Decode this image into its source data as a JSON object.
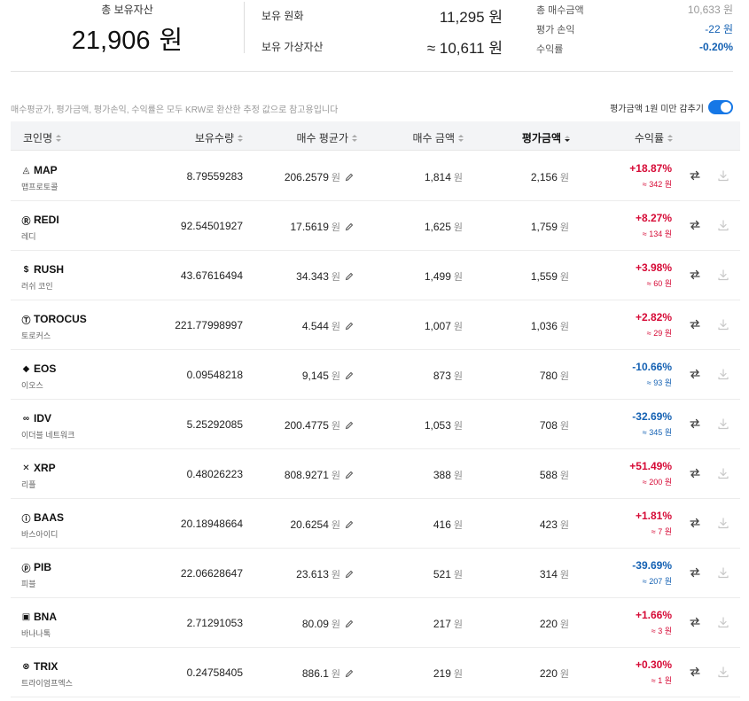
{
  "summary": {
    "total_label": "총 보유자산",
    "total_value": "21,906",
    "total_unit": "원",
    "krw_label": "보유 원화",
    "krw_value": "11,295 원",
    "crypto_label": "보유 가상자산",
    "crypto_value": "≈ 10,611 원",
    "buy_total_label": "총 매수금액",
    "buy_total_value": "10,633 원",
    "pnl_label": "평가 손익",
    "pnl_value": "-22 원",
    "rate_label": "수익률",
    "rate_value": "-0.20%"
  },
  "notice": "매수평균가, 평가금액, 평가손익, 수익률은 모두 KRW로 환산한 추정 값으로 참고용입니다",
  "toggle_label": "평가금액 1원 미만 감추기",
  "toggle_on": true,
  "columns": {
    "coin": "코인명",
    "qty": "보유수량",
    "avg": "매수 평균가",
    "buy": "매수 금액",
    "eval": "평가금액",
    "rate": "수익률"
  },
  "won": "원",
  "colors": {
    "up": "#d60a36",
    "down": "#1461b3",
    "accent": "#1577e6"
  },
  "rows": [
    {
      "symbol": "MAP",
      "name": "맵프로토콜",
      "icon": "map-icon",
      "glyph": "◬",
      "qty": "8.79559283",
      "avg": "206.2579",
      "buy": "1,814",
      "eval": "2,156",
      "pct": "+18.87%",
      "amt": "≈ 342 원",
      "dir": "up"
    },
    {
      "symbol": "REDI",
      "name": "레디",
      "icon": "redi-icon",
      "glyph": "Ⓡ",
      "qty": "92.54501927",
      "avg": "17.5619",
      "buy": "1,625",
      "eval": "1,759",
      "pct": "+8.27%",
      "amt": "≈ 134 원",
      "dir": "up"
    },
    {
      "symbol": "RUSH",
      "name": "러쉬 코인",
      "icon": "rush-icon",
      "glyph": "$",
      "qty": "43.67616494",
      "avg": "34.343",
      "buy": "1,499",
      "eval": "1,559",
      "pct": "+3.98%",
      "amt": "≈ 60 원",
      "dir": "up"
    },
    {
      "symbol": "TOROCUS",
      "name": "토로커스",
      "icon": "torocus-icon",
      "glyph": "Ⓣ",
      "qty": "221.77998997",
      "avg": "4.544",
      "buy": "1,007",
      "eval": "1,036",
      "pct": "+2.82%",
      "amt": "≈ 29 원",
      "dir": "up"
    },
    {
      "symbol": "EOS",
      "name": "이오스",
      "icon": "eos-icon",
      "glyph": "◆",
      "qty": "0.09548218",
      "avg": "9,145",
      "buy": "873",
      "eval": "780",
      "pct": "-10.66%",
      "amt": "≈ 93 원",
      "dir": "down"
    },
    {
      "symbol": "IDV",
      "name": "이더블 네트워크",
      "icon": "idv-icon",
      "glyph": "∞",
      "qty": "5.25292085",
      "avg": "200.4775",
      "buy": "1,053",
      "eval": "708",
      "pct": "-32.69%",
      "amt": "≈ 345 원",
      "dir": "down"
    },
    {
      "symbol": "XRP",
      "name": "리플",
      "icon": "xrp-icon",
      "glyph": "✕",
      "qty": "0.48026223",
      "avg": "808.9271",
      "buy": "388",
      "eval": "588",
      "pct": "+51.49%",
      "amt": "≈ 200 원",
      "dir": "up"
    },
    {
      "symbol": "BAAS",
      "name": "바스아이디",
      "icon": "baas-icon",
      "glyph": "ⓘ",
      "qty": "20.18948664",
      "avg": "20.6254",
      "buy": "416",
      "eval": "423",
      "pct": "+1.81%",
      "amt": "≈ 7 원",
      "dir": "up"
    },
    {
      "symbol": "PIB",
      "name": "피블",
      "icon": "pib-icon",
      "glyph": "ⓟ",
      "qty": "22.06628647",
      "avg": "23.613",
      "buy": "521",
      "eval": "314",
      "pct": "-39.69%",
      "amt": "≈ 207 원",
      "dir": "down"
    },
    {
      "symbol": "BNA",
      "name": "바나나톡",
      "icon": "bna-icon",
      "glyph": "▣",
      "qty": "2.71291053",
      "avg": "80.09",
      "buy": "217",
      "eval": "220",
      "pct": "+1.66%",
      "amt": "≈ 3 원",
      "dir": "up"
    },
    {
      "symbol": "TRIX",
      "name": "트라이엄프엑스",
      "icon": "trix-icon",
      "glyph": "⊗",
      "qty": "0.24758405",
      "avg": "886.1",
      "buy": "219",
      "eval": "220",
      "pct": "+0.30%",
      "amt": "≈ 1 원",
      "dir": "up"
    }
  ]
}
